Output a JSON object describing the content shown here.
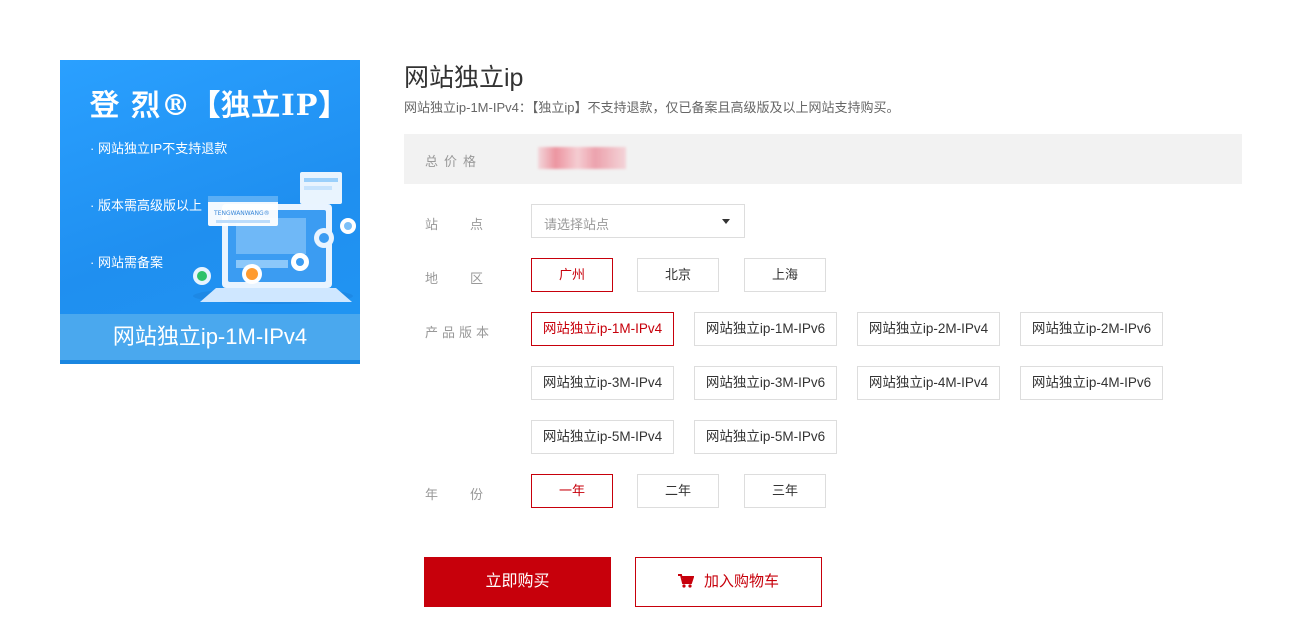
{
  "banner": {
    "title": "登 烈®【独立IP】",
    "bullets": [
      "· 网站独立IP不支持退款",
      "· 版本需高级版以上",
      "· 网站需备案"
    ],
    "illustration_text": "TENGWANWANG®",
    "footer": "网站独立ip-1M-IPv4"
  },
  "product": {
    "title": "网站独立ip",
    "description": "网站独立ip-1M-IPv4：【独立ip】不支持退款，仅已备案且高级版及以上网站支持购买。"
  },
  "price": {
    "label": "总价格"
  },
  "site": {
    "label": [
      "站",
      "点"
    ],
    "placeholder": "请选择站点"
  },
  "region": {
    "label": [
      "地",
      "区"
    ],
    "options": [
      "广州",
      "北京",
      "上海"
    ],
    "selected": "广州"
  },
  "version": {
    "label": "产品版本",
    "options": [
      "网站独立ip-1M-IPv4",
      "网站独立ip-1M-IPv6",
      "网站独立ip-2M-IPv4",
      "网站独立ip-2M-IPv6",
      "网站独立ip-3M-IPv4",
      "网站独立ip-3M-IPv6",
      "网站独立ip-4M-IPv4",
      "网站独立ip-4M-IPv6",
      "网站独立ip-5M-IPv4",
      "网站独立ip-5M-IPv6"
    ],
    "selected": "网站独立ip-1M-IPv4"
  },
  "year": {
    "label": [
      "年",
      "份"
    ],
    "options": [
      "一年",
      "二年",
      "三年"
    ],
    "selected": "一年"
  },
  "actions": {
    "buy": "立即购买",
    "cart": "加入购物车"
  },
  "colors": {
    "accent": "#c7000b",
    "banner_blue": "#1f8ff0",
    "price_row_bg": "#f2f2f2"
  }
}
